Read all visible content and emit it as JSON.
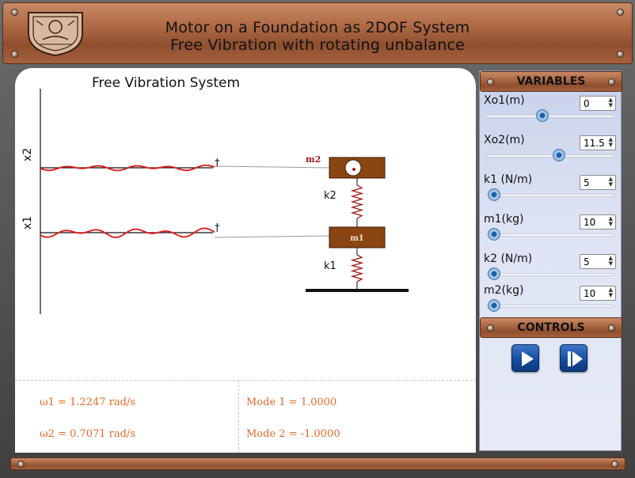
{
  "header": {
    "title_line1": "Motor on a Foundation  as 2DOF System",
    "title_line2": "Free Vibration with rotating unbalance",
    "logo_icon": "institute-emblem-icon"
  },
  "stage": {
    "title": "Free Vibration System",
    "axis_x2": "x2",
    "axis_x1": "x1",
    "spring_k2": "k2",
    "spring_k1": "k1",
    "mass_m2": "m2",
    "mass_m1": "m1"
  },
  "results": {
    "w1": "ω1 = 1.2247 rad/s",
    "w2": "ω2 = 0.7071 rad/s",
    "mode1": "Mode 1 = 1.0000",
    "mode2": "Mode 2 = -1.0000"
  },
  "variables": {
    "header": "VARIABLES",
    "items": [
      {
        "label": "Xo1(m)",
        "value": "0",
        "slider_fraction": 0.43
      },
      {
        "label": "Xo2(m)",
        "value": "11.5",
        "slider_fraction": 0.58
      },
      {
        "label": "k1 (N/m)",
        "value": "5",
        "slider_fraction": 0.0
      },
      {
        "label": "m1(kg)",
        "value": "10",
        "slider_fraction": 0.0
      },
      {
        "label": "k2 (N/m)",
        "value": "5",
        "slider_fraction": 0.0
      },
      {
        "label": "m2(kg)",
        "value": "10",
        "slider_fraction": 0.0
      }
    ]
  },
  "controls": {
    "header": "CONTROLS",
    "play_icon": "play-icon",
    "step_icon": "step-forward-icon"
  },
  "colors": {
    "wood": "#b06c47",
    "result_text": "#e06a2a",
    "wave": "#e01616",
    "control_button": "#134a9c",
    "mass_fill": "#8b4513"
  }
}
